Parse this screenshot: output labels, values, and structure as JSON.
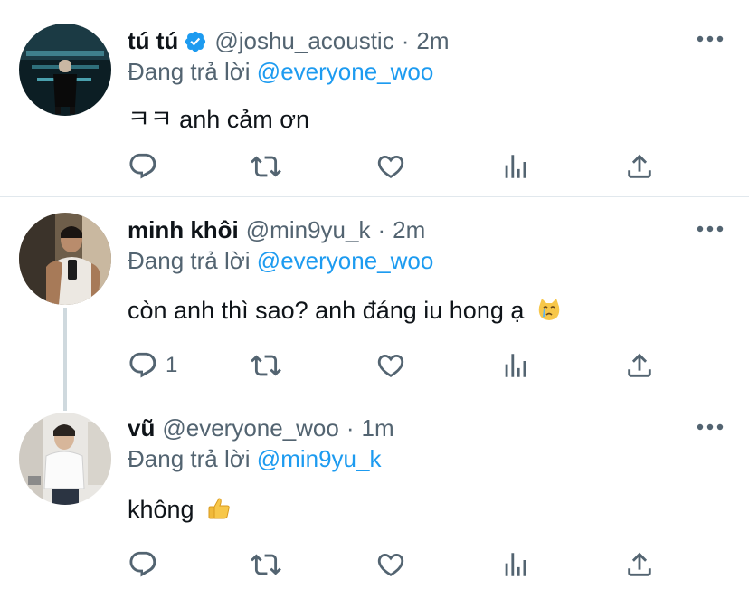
{
  "colors": {
    "accent": "#1d9bf0",
    "muted": "#536471",
    "text": "#0f1419",
    "divider": "#e1e8ed"
  },
  "tweets": [
    {
      "name": "tú tú",
      "verified": true,
      "handle": "@joshu_acoustic",
      "separator": "·",
      "time": "2m",
      "reply_prefix": "Đang trả lời",
      "reply_to": "@everyone_woo",
      "text": "ㅋㅋ anh cảm ơn",
      "reply_count": "",
      "emoji": ""
    },
    {
      "name": "minh khôi",
      "verified": false,
      "handle": "@min9yu_k",
      "separator": "·",
      "time": "2m",
      "reply_prefix": "Đang trả lời",
      "reply_to": "@everyone_woo",
      "text": "còn anh thì sao? anh đáng iu hong ạ",
      "reply_count": "1",
      "emoji": "crying-cat-face"
    },
    {
      "name": "vũ",
      "verified": false,
      "handle": "@everyone_woo",
      "separator": "·",
      "time": "1m",
      "reply_prefix": "Đang trả lời",
      "reply_to": "@min9yu_k",
      "text": "không",
      "reply_count": "",
      "emoji": "thumbs-up"
    }
  ],
  "icons": [
    "more-icon",
    "reply-icon",
    "retweet-icon",
    "like-icon",
    "analytics-icon",
    "share-icon",
    "verified-icon"
  ]
}
